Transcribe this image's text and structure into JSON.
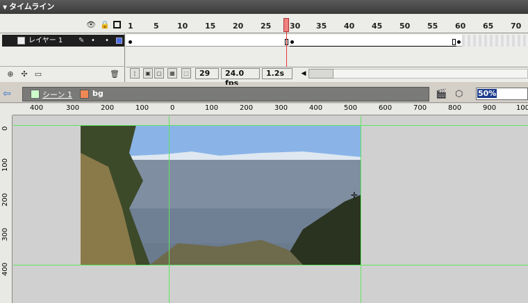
{
  "timeline": {
    "title": "タイムライン",
    "layer_name": "レイヤー 1",
    "frame_numbers": [
      "1",
      "5",
      "10",
      "15",
      "20",
      "25",
      "30",
      "35",
      "40",
      "45",
      "50",
      "55",
      "60",
      "65",
      "70"
    ],
    "current_frame": "29",
    "frame_rate": "24.0 fps",
    "elapsed_time": "1.2s"
  },
  "scene": {
    "scene_name": "シーン 1",
    "symbol_name": "bg",
    "zoom": "50%"
  },
  "rulers": {
    "horizontal": [
      "400",
      "300",
      "200",
      "100",
      "0",
      "100",
      "200",
      "300",
      "400",
      "500",
      "600",
      "700",
      "800",
      "900",
      "100"
    ],
    "vertical": [
      "0",
      "100",
      "200",
      "300",
      "400"
    ]
  },
  "colors": {
    "layer_color": "#4a6fe8",
    "playhead": "#f08080",
    "guide": "#5fe65f"
  }
}
